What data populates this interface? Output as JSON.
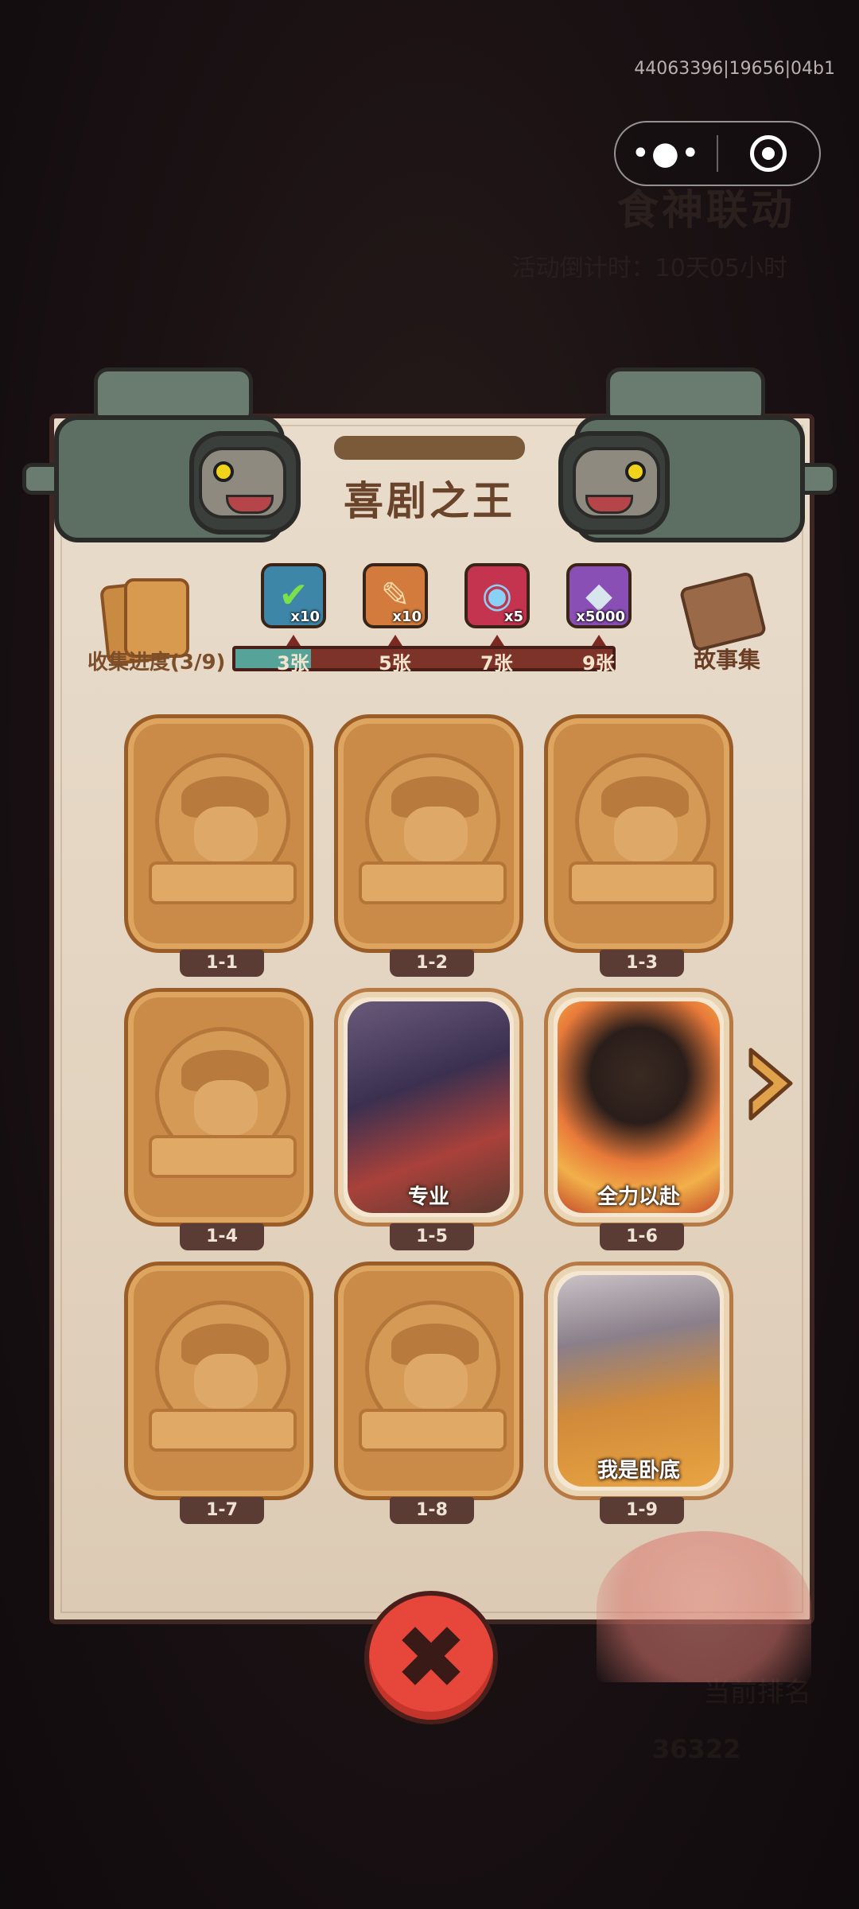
{
  "system": {
    "id_text": "44063396|19656|04b1"
  },
  "background": {
    "title": "食神联动",
    "timer": "活动倒计时：10天05小时",
    "bottom_text": "当前排名",
    "score": "36322"
  },
  "dialog": {
    "title": "喜剧之王",
    "collect_label": "收集进度(3/9)",
    "collect_progress": {
      "collected": 3,
      "total": 9
    },
    "story_label": "故事集",
    "rewards": [
      {
        "icon": "green-check-card-icon",
        "qty": "x10",
        "color": "#3e86a8"
      },
      {
        "icon": "orange-ticket-icon",
        "qty": "x10",
        "color": "#d27b3c"
      },
      {
        "icon": "rainbow-disc-icon",
        "qty": "x5",
        "color": "#c4344e"
      },
      {
        "icon": "purple-crystal-icon",
        "qty": "x5000",
        "color": "#8a4fb4"
      }
    ],
    "milestones": [
      "3张",
      "5张",
      "7张",
      "9张"
    ],
    "cards": [
      {
        "index": "1-1",
        "revealed": false,
        "caption": ""
      },
      {
        "index": "1-2",
        "revealed": false,
        "caption": ""
      },
      {
        "index": "1-3",
        "revealed": false,
        "caption": ""
      },
      {
        "index": "1-4",
        "revealed": false,
        "caption": ""
      },
      {
        "index": "1-5",
        "revealed": true,
        "caption": "专业"
      },
      {
        "index": "1-6",
        "revealed": true,
        "caption": "全力以赴"
      },
      {
        "index": "1-7",
        "revealed": false,
        "caption": ""
      },
      {
        "index": "1-8",
        "revealed": false,
        "caption": ""
      },
      {
        "index": "1-9",
        "revealed": true,
        "caption": "我是卧底"
      }
    ]
  },
  "colors": {
    "close_button": "#e7463a",
    "progress_fill": "#56a39a",
    "progress_track": "#7e3328"
  }
}
